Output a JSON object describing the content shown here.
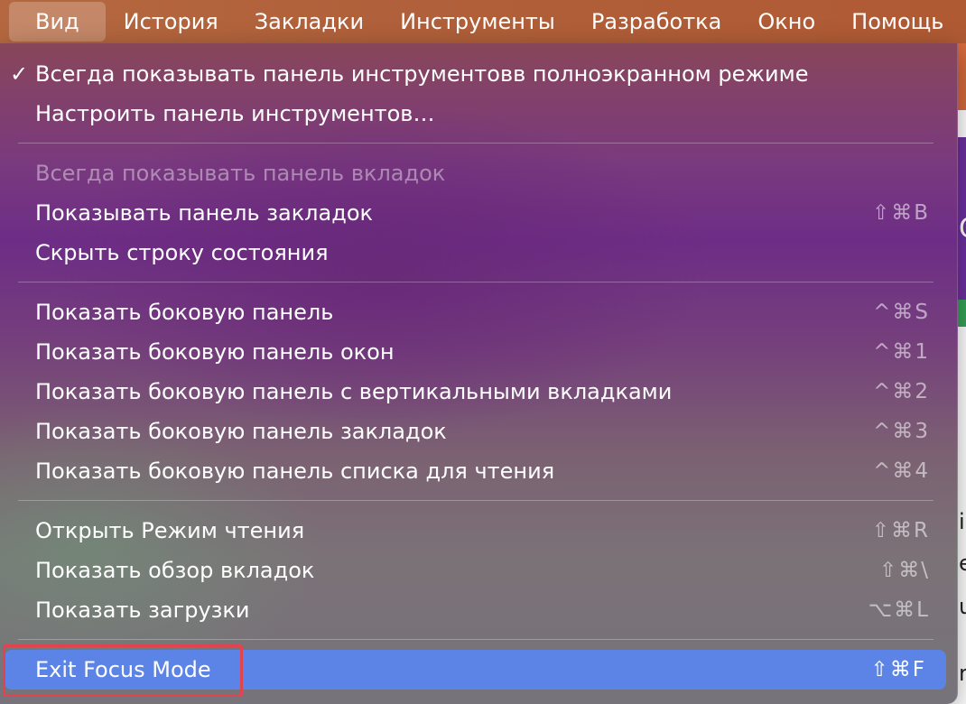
{
  "menubar": {
    "items": [
      {
        "label": "Вид"
      },
      {
        "label": "История"
      },
      {
        "label": "Закладки"
      },
      {
        "label": "Инструменты"
      },
      {
        "label": "Разработка"
      },
      {
        "label": "Окно"
      },
      {
        "label": "Помощь"
      }
    ]
  },
  "background_page": {
    "letters": [
      "C",
      "i",
      "e",
      "u",
      "r"
    ]
  },
  "menu": {
    "items": [
      {
        "label": "Всегда показывать панель инструментовв полноэкранном режиме",
        "check": "✓",
        "shortcut": ""
      },
      {
        "label": "Настроить панель инструментов…",
        "check": "",
        "shortcut": ""
      },
      {
        "label": "Всегда показывать панель вкладок",
        "check": "",
        "shortcut": "",
        "state": "disabled"
      },
      {
        "label": "Показывать панель закладок",
        "check": "",
        "shortcut": "⇧⌘B"
      },
      {
        "label": "Скрыть строку состояния",
        "check": "",
        "shortcut": ""
      },
      {
        "label": "Показать боковую панель",
        "check": "",
        "shortcut": "^⌘S"
      },
      {
        "label": "Показать боковую панель окон",
        "check": "",
        "shortcut": "^⌘1"
      },
      {
        "label": "Показать боковую панель с вертикальными вкладками",
        "check": "",
        "shortcut": "^⌘2"
      },
      {
        "label": "Показать боковую панель закладок",
        "check": "",
        "shortcut": "^⌘3"
      },
      {
        "label": "Показать боковую панель списка для чтения",
        "check": "",
        "shortcut": "^⌘4"
      },
      {
        "label": "Открыть Режим чтения",
        "check": "",
        "shortcut": "⇧⌘R"
      },
      {
        "label": "Показать обзор вкладок",
        "check": "",
        "shortcut": "⇧⌘\\"
      },
      {
        "label": "Показать загрузки",
        "check": "",
        "shortcut": "⌥⌘L"
      },
      {
        "label": "Exit Focus Mode",
        "check": "",
        "shortcut": "⇧⌘F",
        "state": "highlighted"
      }
    ]
  },
  "colors": {
    "menubar": "#b0603a",
    "highlight": "#5b84e6",
    "focus_ring": "#e2444f"
  }
}
